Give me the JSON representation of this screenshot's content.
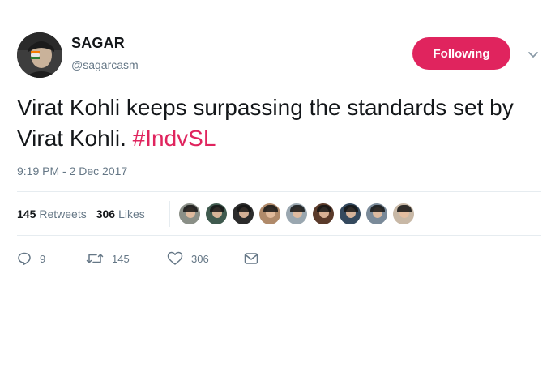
{
  "author": {
    "display_name": "SAGAR",
    "handle": "@sagarcasm"
  },
  "follow_button": {
    "label": "Following",
    "color": "#e0245e"
  },
  "tweet": {
    "text": "Virat Kohli keeps surpassing the standards set by Virat Kohli.",
    "hashtag": "#IndvSL",
    "hashtag_color": "#e0245e",
    "timestamp": "9:19 PM - 2 Dec 2017"
  },
  "stats": {
    "retweets_count": "145",
    "retweets_label": "Retweets",
    "likes_count": "306",
    "likes_label": "Likes"
  },
  "likers": [
    {
      "name": "liker-1",
      "color": "#8a8f87"
    },
    {
      "name": "liker-2",
      "color": "#3f5a4e"
    },
    {
      "name": "liker-3",
      "color": "#2b2b2b"
    },
    {
      "name": "liker-4",
      "color": "#b08a6a"
    },
    {
      "name": "liker-5",
      "color": "#9aa7b0"
    },
    {
      "name": "liker-6",
      "color": "#5a3a2a"
    },
    {
      "name": "liker-7",
      "color": "#34495e"
    },
    {
      "name": "liker-8",
      "color": "#7a8a99"
    },
    {
      "name": "liker-9",
      "color": "#c8b8a6"
    }
  ],
  "actions": {
    "reply_count": "9",
    "retweet_count": "145",
    "like_count": "306"
  },
  "icons": {
    "reply": "reply-icon",
    "retweet": "retweet-icon",
    "like": "heart-icon",
    "dm": "envelope-icon",
    "caret": "chevron-down-icon"
  }
}
